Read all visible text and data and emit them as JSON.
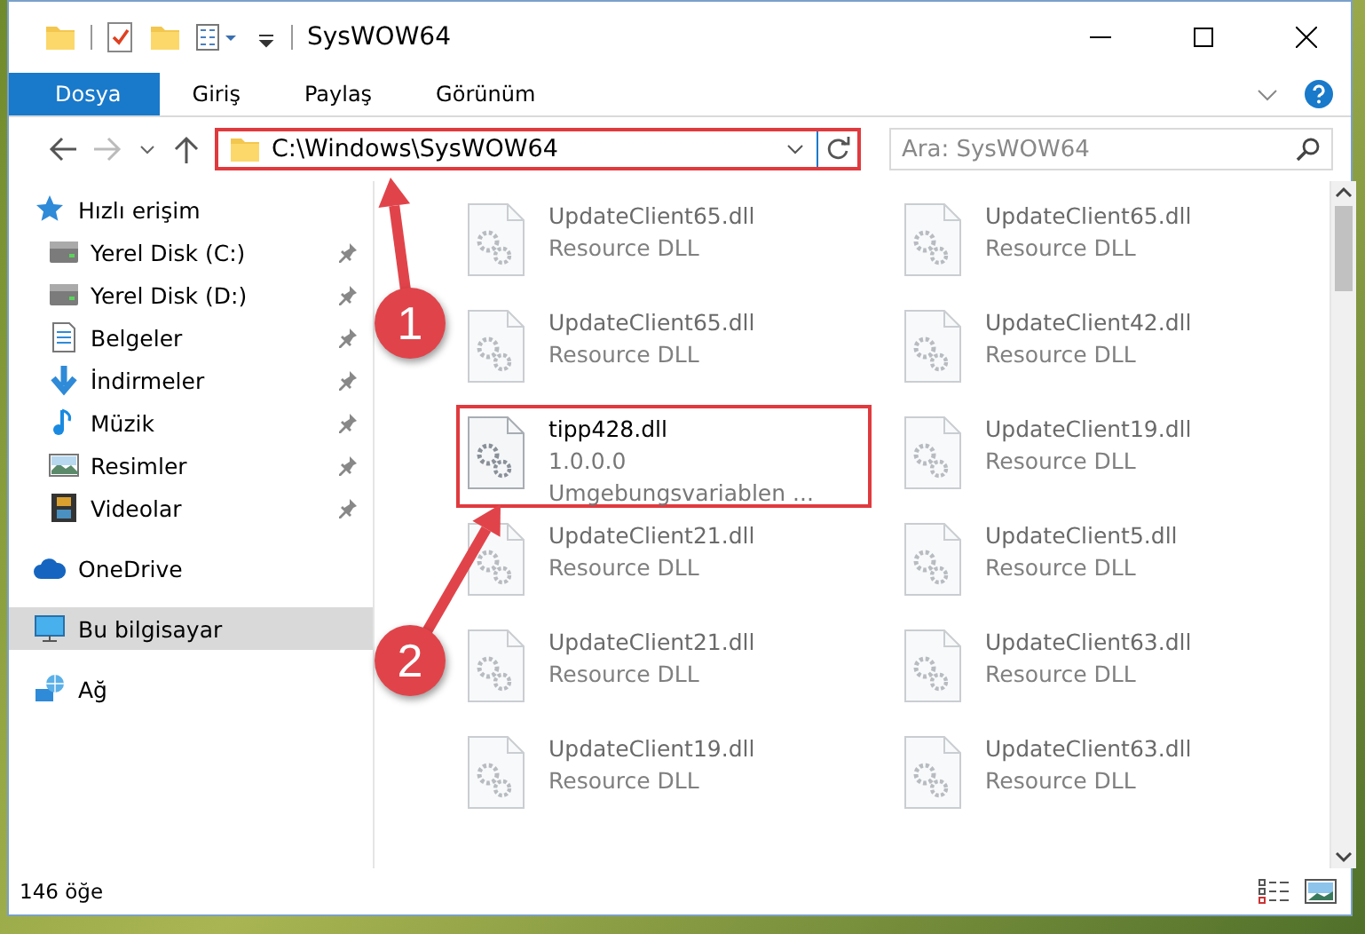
{
  "window": {
    "title": "SysWOW64"
  },
  "ribbon": {
    "tabs": [
      {
        "label": "Dosya",
        "selected": true
      },
      {
        "label": "Giriş",
        "selected": false
      },
      {
        "label": "Paylaş",
        "selected": false
      },
      {
        "label": "Görünüm",
        "selected": false
      }
    ]
  },
  "address_bar": {
    "path": "C:\\Windows\\SysWOW64",
    "highlighted": true
  },
  "search": {
    "placeholder": "Ara: SysWOW64"
  },
  "navigation": [
    {
      "label": "Hızlı erişim",
      "kind": "star",
      "selected": false,
      "children": [
        {
          "label": "Yerel Disk (C:)",
          "kind": "drive",
          "pinned": true,
          "selected": false
        },
        {
          "label": "Yerel Disk (D:)",
          "kind": "drive",
          "pinned": true,
          "selected": false
        },
        {
          "label": "Belgeler",
          "kind": "document",
          "pinned": true,
          "selected": false
        },
        {
          "label": "İndirmeler",
          "kind": "download",
          "pinned": true,
          "selected": false
        },
        {
          "label": "Müzik",
          "kind": "music",
          "pinned": true,
          "selected": false
        },
        {
          "label": "Resimler",
          "kind": "picture",
          "pinned": true,
          "selected": false
        },
        {
          "label": "Videolar",
          "kind": "video",
          "pinned": true,
          "selected": false
        }
      ]
    },
    {
      "label": "OneDrive",
      "kind": "cloud",
      "selected": false
    },
    {
      "label": "Bu bilgisayar",
      "kind": "computer",
      "selected": true
    },
    {
      "label": "Ağ",
      "kind": "network",
      "selected": false
    }
  ],
  "files": [
    {
      "name": "UpdateClient65.dll",
      "lines": [
        "Resource DLL"
      ],
      "blurred": true,
      "highlighted": false
    },
    {
      "name": "UpdateClient65.dll",
      "lines": [
        "Resource DLL"
      ],
      "blurred": true,
      "highlighted": false
    },
    {
      "name": "UpdateClient65.dll",
      "lines": [
        "Resource DLL"
      ],
      "blurred": true,
      "highlighted": false
    },
    {
      "name": "UpdateClient42.dll",
      "lines": [
        "Resource DLL"
      ],
      "blurred": true,
      "highlighted": false
    },
    {
      "name": "tipp428.dll",
      "lines": [
        "1.0.0.0",
        "Umgebungsvariablen ..."
      ],
      "blurred": false,
      "highlighted": true
    },
    {
      "name": "UpdateClient19.dll",
      "lines": [
        "Resource DLL"
      ],
      "blurred": true,
      "highlighted": false
    },
    {
      "name": "UpdateClient21.dll",
      "lines": [
        "Resource DLL"
      ],
      "blurred": true,
      "highlighted": false
    },
    {
      "name": "UpdateClient5.dll",
      "lines": [
        "Resource DLL"
      ],
      "blurred": true,
      "highlighted": false
    },
    {
      "name": "UpdateClient21.dll",
      "lines": [
        "Resource DLL"
      ],
      "blurred": true,
      "highlighted": false
    },
    {
      "name": "UpdateClient63.dll",
      "lines": [
        "Resource DLL"
      ],
      "blurred": true,
      "highlighted": false
    },
    {
      "name": "UpdateClient19.dll",
      "lines": [
        "Resource DLL"
      ],
      "blurred": true,
      "highlighted": false
    },
    {
      "name": "UpdateClient63.dll",
      "lines": [
        "Resource DLL"
      ],
      "blurred": true,
      "highlighted": false
    }
  ],
  "status_bar": {
    "item_count": "146 öğe"
  },
  "annotations": [
    {
      "number": "1"
    },
    {
      "number": "2"
    }
  ]
}
